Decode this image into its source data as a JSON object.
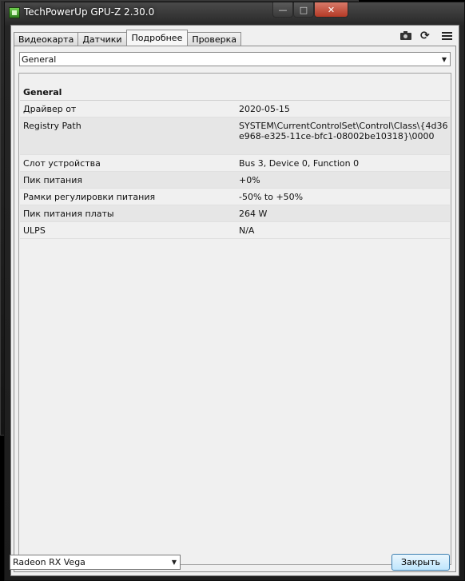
{
  "window": {
    "title": "TechPowerUp GPU-Z 2.30.0",
    "controls": {
      "minimize": "—",
      "maximize": "□",
      "close": "✕"
    }
  },
  "tabs": [
    {
      "label": "Видеокарта",
      "active": false
    },
    {
      "label": "Датчики",
      "active": false
    },
    {
      "label": "Подробнее",
      "active": true
    },
    {
      "label": "Проверка",
      "active": false
    }
  ],
  "toolbar": {
    "icons": [
      "camera-icon",
      "refresh-icon",
      "menu-icon"
    ],
    "refresh_glyph": "⟳"
  },
  "category_select": {
    "value": "General",
    "arrow": "▼"
  },
  "details": {
    "section": "General",
    "rows": [
      {
        "key": "Драйвер от",
        "value": "2020-05-15"
      },
      {
        "key": "Registry Path",
        "value": "SYSTEM\\CurrentControlSet\\Control\\Class\\{4d36e968-e325-11ce-bfc1-08002be10318}\\0000"
      },
      {
        "key": "Слот устройства",
        "value": "Bus 3, Device 0, Function 0"
      },
      {
        "key": "Пик питания",
        "value": "+0%"
      },
      {
        "key": "Рамки регулировки питания",
        "value": "-50% to +50%"
      },
      {
        "key": "Пик питания платы",
        "value": "264 W"
      },
      {
        "key": "ULPS",
        "value": "N/A"
      }
    ]
  },
  "footer": {
    "gpu_select": {
      "value": "Radeon RX Vega",
      "arrow": "▼"
    },
    "close_label": "Закрыть"
  }
}
